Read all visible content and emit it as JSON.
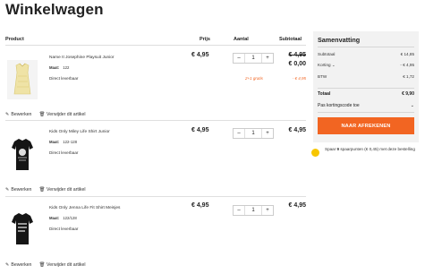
{
  "page": {
    "title": "Winkelwagen"
  },
  "table_headers": {
    "product": "Product",
    "price": "Prijs",
    "quantity": "Aantal",
    "subtotal": "Subtotaal"
  },
  "items": [
    {
      "name": "Name It Josephine Playsuit Junior",
      "size_label": "Maat:",
      "size": "122",
      "availability": "Direct leverbaar",
      "price": "€ 4,95",
      "quantity": "1",
      "subtotal": "€ 4,95",
      "subtotal_after": "€ 0,00",
      "promo_label": "2+1 gratis",
      "promo_amount": "- € 4,95",
      "edit_label": "Bewerken",
      "remove_label": "Verwijder dit artikel"
    },
    {
      "name": "Kids Only Miley Life Shirt Junior",
      "size_label": "Maat:",
      "size": "122-128",
      "availability": "Direct leverbaar",
      "price": "€ 4,95",
      "quantity": "1",
      "subtotal": "€ 4,95",
      "edit_label": "Bewerken",
      "remove_label": "Verwijder dit artikel"
    },
    {
      "name": "Kids Only Jenna Life Fit Shirt Meisjes",
      "size_label": "Maat:",
      "size": "122/128",
      "availability": "Direct leverbaar",
      "price": "€ 4,95",
      "quantity": "1",
      "subtotal": "€ 4,95",
      "edit_label": "Bewerken",
      "remove_label": "Verwijder dit artikel"
    }
  ],
  "quantity_controls": {
    "minus": "–",
    "plus": "+"
  },
  "summary": {
    "title": "Samenvatting",
    "subtotal_label": "Subtotaal",
    "subtotal_value": "€ 14,85",
    "discount_label": "Korting",
    "discount_value": "- € 4,95",
    "tax_label": "BTW",
    "tax_value": "€ 1,72",
    "total_label": "Totaal",
    "total_value": "€ 9,90",
    "code_label": "Pas kortingscode toe",
    "checkout_label": "NAAR AFREKENEN"
  },
  "loyalty": {
    "text_before": "Spaar ",
    "points": "9",
    "text_after": " spaarpunten (€ 0,45) met deze bestelling"
  },
  "colors": {
    "accent": "#f26522",
    "summary_bg": "#f2f2f2"
  }
}
